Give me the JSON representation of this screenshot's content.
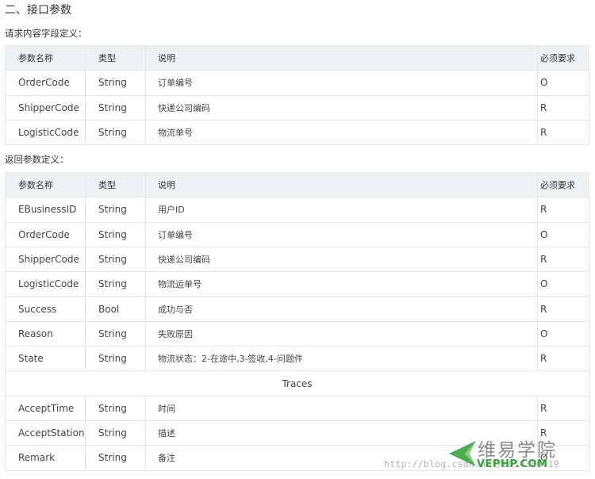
{
  "heading": "二、接口参数",
  "request": {
    "label": "请求内容字段定义：",
    "headers": [
      "参数名称",
      "类型",
      "说明",
      "必须要求"
    ],
    "rows": [
      [
        "OrderCode",
        "String",
        "订单编号",
        "O"
      ],
      [
        "ShipperCode",
        "String",
        "快递公司编码",
        "R"
      ],
      [
        "LogisticCode",
        "String",
        "物流单号",
        "R"
      ]
    ]
  },
  "response": {
    "label": "返回参数定义：",
    "headers": [
      "参数名称",
      "类型",
      "说明",
      "必须要求"
    ],
    "rows": [
      [
        "EBusinessID",
        "String",
        "用户ID",
        "R"
      ],
      [
        "OrderCode",
        "String",
        "订单编号",
        "O"
      ],
      [
        "ShipperCode",
        "String",
        "快递公司编码",
        "R"
      ],
      [
        "LogisticCode",
        "String",
        "物流运单号",
        "O"
      ],
      [
        "Success",
        "Bool",
        "成功与否",
        "R"
      ],
      [
        "Reason",
        "String",
        "失败原因",
        "O"
      ],
      [
        "State",
        "String",
        "物流状态：2-在途中,3-签收,4-问题件",
        "R"
      ]
    ],
    "group_label": "Traces",
    "trace_rows": [
      [
        "AcceptTime",
        "String",
        "时间",
        "R"
      ],
      [
        "AcceptStation",
        "String",
        "描述",
        "R"
      ],
      [
        "Remark",
        "String",
        "备注",
        "O"
      ]
    ]
  },
  "watermark": {
    "url": "http://blog.csdn.net/u014380419",
    "brand_cn": "维易学院",
    "brand_en": "VEPHP.COM",
    "brand_color": "#35a33c"
  }
}
